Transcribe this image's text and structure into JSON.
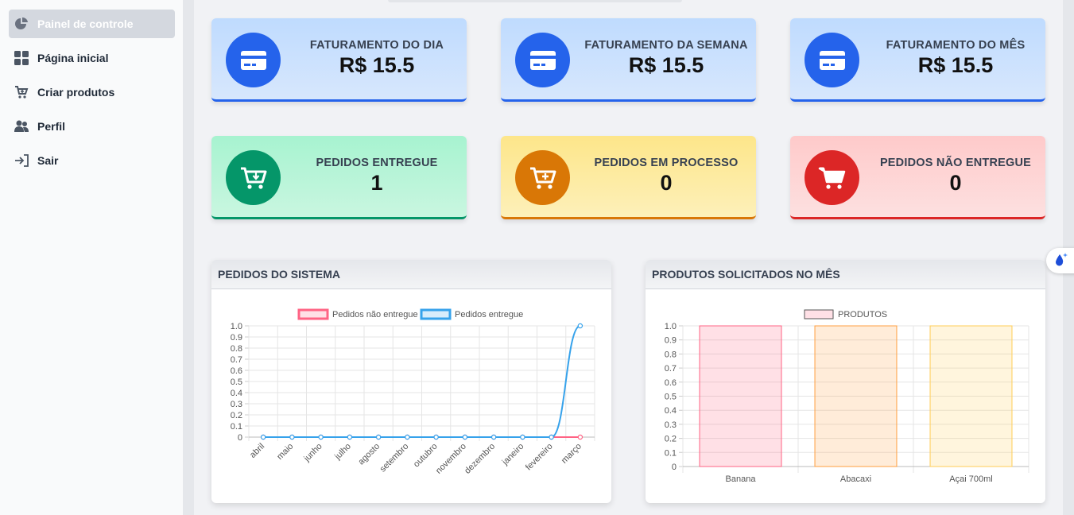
{
  "sidebar": {
    "items": [
      {
        "label": "Painel de controle",
        "icon": "pie-chart-icon",
        "active": true
      },
      {
        "label": "Página inicial",
        "icon": "grid-icon"
      },
      {
        "label": "Criar produtos",
        "icon": "cart-add-icon"
      },
      {
        "label": "Perfil",
        "icon": "users-icon"
      },
      {
        "label": "Sair",
        "icon": "sign-out-icon"
      }
    ]
  },
  "cards": {
    "billing_day": {
      "title": "FATURAMENTO DO DIA",
      "value": "R$ 15.5",
      "icon": "credit-card-icon"
    },
    "billing_week": {
      "title": "FATURAMENTO DA SEMANA",
      "value": "R$ 15.5",
      "icon": "credit-card-icon"
    },
    "billing_month": {
      "title": "FATURAMENTO DO MÊS",
      "value": "R$ 15.5",
      "icon": "credit-card-icon"
    },
    "orders_delivered": {
      "title": "PEDIDOS ENTREGUE",
      "value": "1",
      "icon": "cart-download-icon"
    },
    "orders_processing": {
      "title": "PEDIDOS EM PROCESSO",
      "value": "0",
      "icon": "cart-plus-icon"
    },
    "orders_not_delivered": {
      "title": "PEDIDOS NÃO ENTREGUE",
      "value": "0",
      "icon": "cart-icon"
    }
  },
  "colors": {
    "blue": "#2563eb",
    "green": "#059669",
    "orange": "#d97706",
    "red": "#dc2626",
    "line_pink": "#ff6384",
    "line_blue": "#36a2eb"
  },
  "panels": {
    "orders_title": "PEDIDOS DO SISTEMA",
    "products_title": "PRODUTOS SOLICITADOS NO MÊS"
  },
  "chart_data": [
    {
      "type": "line",
      "title": "PEDIDOS DO SISTEMA",
      "categories": [
        "abril",
        "maio",
        "junho",
        "julho",
        "agosto",
        "setembro",
        "outubro",
        "novembro",
        "dezembro",
        "janeiro",
        "fevereiro",
        "março"
      ],
      "series": [
        {
          "name": "Pedidos não entregue",
          "values": [
            0,
            0,
            0,
            0,
            0,
            0,
            0,
            0,
            0,
            0,
            0,
            0
          ],
          "color": "#ff6384"
        },
        {
          "name": "Pedidos entregue",
          "values": [
            0,
            0,
            0,
            0,
            0,
            0,
            0,
            0,
            0,
            0,
            0,
            1
          ],
          "color": "#36a2eb"
        }
      ],
      "ylim": [
        0,
        1
      ],
      "yticks": [
        "1.0",
        "0.9",
        "0.8",
        "0.7",
        "0.6",
        "0.5",
        "0.4",
        "0.3",
        "0.2",
        "0.1",
        "0"
      ],
      "legend": "top-center",
      "grid": true
    },
    {
      "type": "bar",
      "title": "PRODUTOS SOLICITADOS NO MÊS",
      "categories": [
        "Banana",
        "Abacaxi",
        "Açai 700ml"
      ],
      "series": [
        {
          "name": "PRODUTOS",
          "values": [
            1,
            1,
            1
          ]
        }
      ],
      "bar_colors": [
        "#ff6384",
        "#ff9f40",
        "#ffcd56"
      ],
      "ylim": [
        0,
        1
      ],
      "yticks": [
        "1.0",
        "0.9",
        "0.8",
        "0.7",
        "0.6",
        "0.5",
        "0.4",
        "0.3",
        "0.2",
        "0.1",
        "0"
      ],
      "legend": "top-center",
      "grid": true
    }
  ]
}
